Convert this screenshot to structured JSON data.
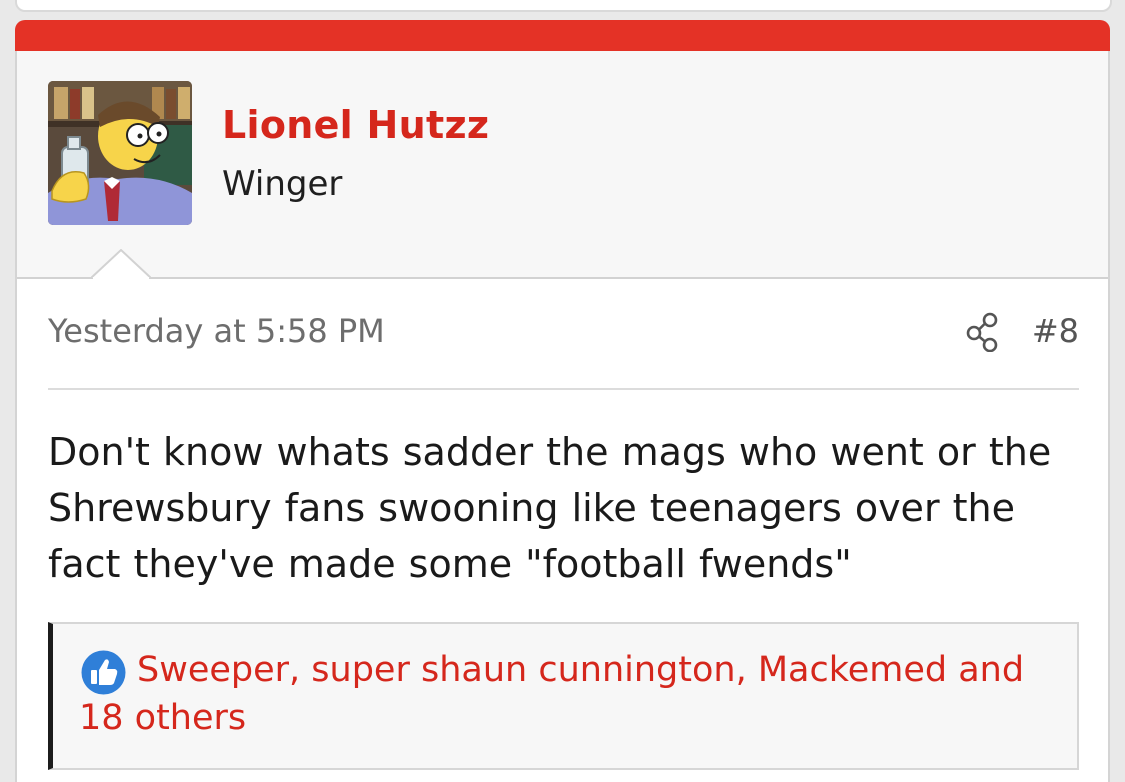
{
  "author": {
    "name": "Lionel Hutzz",
    "title": "Winger"
  },
  "post": {
    "date": "Yesterday at 5:58 PM",
    "number": "#8",
    "body": "Don't know whats sadder the mags who went or the Shrewsbury fans swooning like teenagers over the fact they've made some \"football fwends\""
  },
  "reactions": {
    "text": "Sweeper, super shaun cunnington, Mackemed and 18 others",
    "icon": "like-icon"
  },
  "colors": {
    "accent": "#e43226",
    "link": "#d5271c",
    "like_blue": "#2f7fd8"
  }
}
